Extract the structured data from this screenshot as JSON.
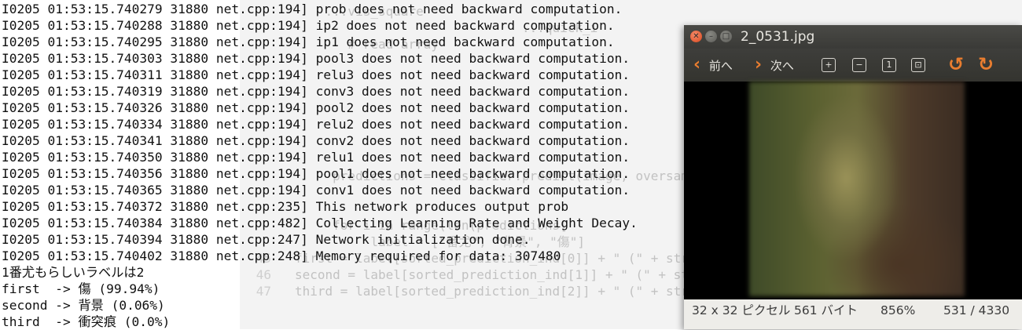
{
  "editor": {
    "lines": [
      {
        "num": "",
        "text": "    ...vis_square"
      },
      {
        "num": "",
        "text": "                              ...quick_i"
      },
      {
        "num": "",
        "text": "       # read array"
      },
      {
        "num": "",
        "text": ""
      },
      {
        "num": "",
        "text": ""
      },
      {
        "num": "",
        "text": ""
      },
      {
        "num": "",
        "text": ""
      },
      {
        "num": "",
        "text": ""
      },
      {
        "num": "",
        "text": ""
      },
      {
        "num": "",
        "text": ""
      },
      {
        "num": "",
        "text": "     predictions = classifier.predict(image, oversample="
      },
      {
        "num": "",
        "text": ""
      },
      {
        "num": "",
        "text": ""
      },
      {
        "num": "",
        "text": "     for i in range(len(predictions["
      },
      {
        "num": "",
        "text": "          label = [\"番尤\", \"背景\", \"傷\"]"
      },
      {
        "num": "45",
        "text": "first = label[sorted_prediction_ind[0]] + \" (\" + str("
      },
      {
        "num": "46",
        "text": "second = label[sorted_prediction_ind[1]] + \" (\" + str("
      },
      {
        "num": "47",
        "text": "third = label[sorted_prediction_ind[2]] + \" (\" + str("
      }
    ]
  },
  "terminal": {
    "lines": [
      "I0205 01:53:15.740279 31880 net.cpp:194] prob does not need backward computation.",
      "I0205 01:53:15.740288 31880 net.cpp:194] ip2 does not need backward computation.",
      "I0205 01:53:15.740295 31880 net.cpp:194] ip1 does not need backward computation.",
      "I0205 01:53:15.740303 31880 net.cpp:194] pool3 does not need backward computation.",
      "I0205 01:53:15.740311 31880 net.cpp:194] relu3 does not need backward computation.",
      "I0205 01:53:15.740319 31880 net.cpp:194] conv3 does not need backward computation.",
      "I0205 01:53:15.740326 31880 net.cpp:194] pool2 does not need backward computation.",
      "I0205 01:53:15.740334 31880 net.cpp:194] relu2 does not need backward computation.",
      "I0205 01:53:15.740341 31880 net.cpp:194] conv2 does not need backward computation.",
      "I0205 01:53:15.740350 31880 net.cpp:194] relu1 does not need backward computation.",
      "I0205 01:53:15.740356 31880 net.cpp:194] pool1 does not need backward computation.",
      "I0205 01:53:15.740365 31880 net.cpp:194] conv1 does not need backward computation.",
      "I0205 01:53:15.740372 31880 net.cpp:235] This network produces output prob",
      "I0205 01:53:15.740384 31880 net.cpp:482] Collecting Learning Rate and Weight Decay.",
      "I0205 01:53:15.740394 31880 net.cpp:247] Network initialization done.",
      "I0205 01:53:15.740402 31880 net.cpp:248] Memory required for data: 307480",
      "1番尤もらしいラベルは2",
      "first  -> 傷 (99.94%)",
      "second -> 背景 (0.06%)",
      "third  -> 衝突痕 (0.0%)"
    ]
  },
  "viewer": {
    "title": "2_0531.jpg",
    "prev_label": "前へ",
    "next_label": "次へ",
    "icons": {
      "zoom_in": "zoom-in-icon",
      "zoom_out": "zoom-out-icon",
      "zoom_normal": "zoom-normal-icon",
      "zoom_fit": "zoom-fit-icon",
      "rotate_left": "rotate-left-icon",
      "rotate_right": "rotate-right-icon"
    },
    "status": {
      "dimensions": "32 x 32 ピクセル",
      "filesize": "561 バイト",
      "zoom": "856%",
      "position": "531 / 4330"
    }
  },
  "colors": {
    "accent": "#e97d2f",
    "close_button": "#e0552a",
    "titlebar": "#3c3b37"
  }
}
